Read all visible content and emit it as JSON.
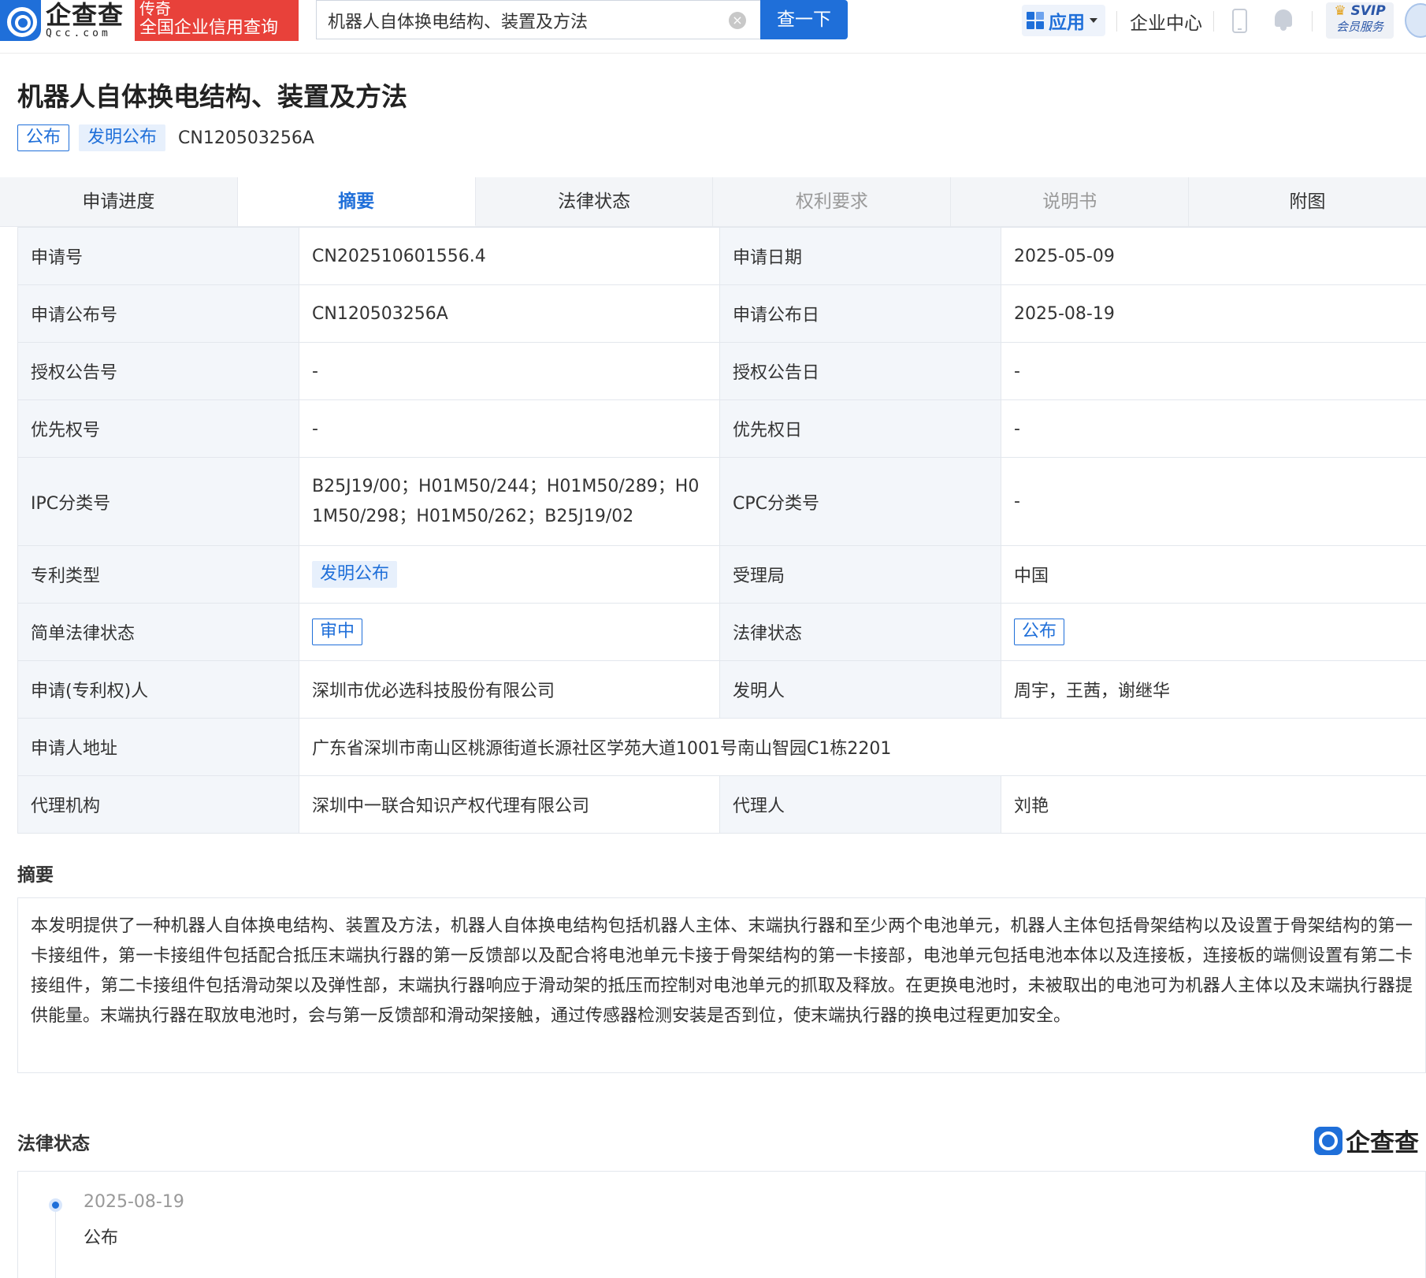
{
  "header": {
    "logo_cn": "企查查",
    "logo_en": "Qcc.com",
    "brand_line1": "传奇",
    "brand_line2": "全国企业信用查询",
    "search_value": "机器人自体换电结构、装置及方法",
    "clear_icon": "clear-icon",
    "search_button": "查一下",
    "apps_label": "应用",
    "enterprise_center": "企业中心",
    "svip_line1": "SVIP",
    "svip_line2": "会员服务"
  },
  "patent": {
    "title": "机器人自体换电结构、装置及方法",
    "tag_status": "公布",
    "tag_type": "发明公布",
    "pub_number": "CN120503256A"
  },
  "tabs": [
    {
      "label": "申请进度",
      "state": "normal"
    },
    {
      "label": "摘要",
      "state": "active"
    },
    {
      "label": "法律状态",
      "state": "normal"
    },
    {
      "label": "权利要求",
      "state": "muted"
    },
    {
      "label": "说明书",
      "state": "muted"
    },
    {
      "label": "附图",
      "state": "normal"
    }
  ],
  "info": {
    "app_no_label": "申请号",
    "app_no": "CN202510601556.4",
    "app_date_label": "申请日期",
    "app_date": "2025-05-09",
    "pub_no_label": "申请公布号",
    "pub_no": "CN120503256A",
    "pub_date_label": "申请公布日",
    "pub_date": "2025-08-19",
    "grant_no_label": "授权公告号",
    "grant_no": "-",
    "grant_date_label": "授权公告日",
    "grant_date": "-",
    "priority_no_label": "优先权号",
    "priority_no": "-",
    "priority_date_label": "优先权日",
    "priority_date": "-",
    "ipc_label": "IPC分类号",
    "ipc": "B25J19/00；H01M50/244；H01M50/289；H01M50/298；H01M50/262；B25J19/02",
    "cpc_label": "CPC分类号",
    "cpc": "-",
    "patent_type_label": "专利类型",
    "patent_type": "发明公布",
    "office_label": "受理局",
    "office": "中国",
    "simple_legal_label": "简单法律状态",
    "simple_legal": "审中",
    "legal_label": "法律状态",
    "legal": "公布",
    "applicant_label": "申请(专利权)人",
    "applicant": "深圳市优必选科技股份有限公司",
    "inventor_label": "发明人",
    "inventor": "周宇，王茜，谢继华",
    "address_label": "申请人地址",
    "address": "广东省深圳市南山区桃源街道长源社区学苑大道1001号南山智园C1栋2201",
    "agency_label": "代理机构",
    "agency": "深圳中一联合知识产权代理有限公司",
    "agent_label": "代理人",
    "agent": "刘艳"
  },
  "abstract": {
    "title": "摘要",
    "text": "本发明提供了一种机器人自体换电结构、装置及方法，机器人自体换电结构包括机器人主体、末端执行器和至少两个电池单元，机器人主体包括骨架结构以及设置于骨架结构的第一卡接组件，第一卡接组件包括配合抵压末端执行器的第一反馈部以及配合将电池单元卡接于骨架结构的第一卡接部，电池单元包括电池本体以及连接板，连接板的端侧设置有第二卡接组件，第二卡接组件包括滑动架以及弹性部，末端执行器响应于滑动架的抵压而控制对电池单元的抓取及释放。在更换电池时，未被取出的电池可为机器人主体以及末端执行器提供能量。末端执行器在取放电池时，会与第一反馈部和滑动架接触，通过传感器检测安装是否到位，使末端执行器的换电过程更加安全。"
  },
  "legal_status": {
    "title": "法律状态",
    "watermark": "企查查",
    "events": [
      {
        "date": "2025-08-19",
        "status": "公布"
      }
    ]
  },
  "colors": {
    "brand_blue": "#1f6fd9",
    "brand_red": "#e8413a",
    "key_cell_bg": "#f3f6fa"
  }
}
